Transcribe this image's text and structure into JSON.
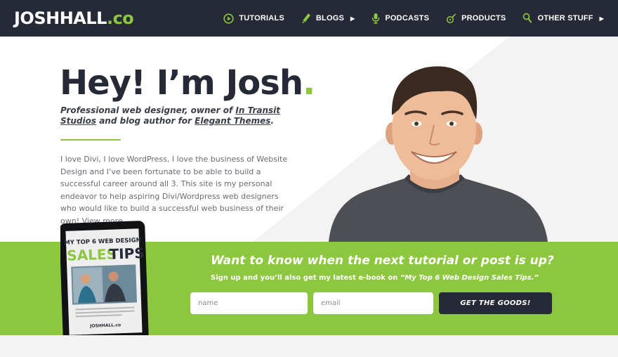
{
  "site": {
    "logo_main": "JOSHHALL",
    "logo_tld": ".co"
  },
  "nav": {
    "items": [
      {
        "label": "TUTORIALS",
        "icon": "play-circle-icon",
        "has_dropdown": false
      },
      {
        "label": "BLOGS",
        "icon": "pencil-icon",
        "has_dropdown": true
      },
      {
        "label": "PODCASTS",
        "icon": "microphone-icon",
        "has_dropdown": false
      },
      {
        "label": "PRODUCTS",
        "icon": "guitar-pick-icon",
        "has_dropdown": false
      },
      {
        "label": "OTHER STUFF",
        "icon": "magnifier-icon",
        "has_dropdown": true
      }
    ],
    "dropdown_glyph": "▶"
  },
  "hero": {
    "title": "Hey! I’m Josh",
    "title_dot": ".",
    "subtitle_pre": "Professional web designer, owner of ",
    "subtitle_link1": "In Transit Studios",
    "subtitle_mid": " and blog author for ",
    "subtitle_link2": "Elegant Themes",
    "subtitle_post": ".",
    "bio": "I love Divi, I love WordPress, I love the business of Website Design and I’ve been fortunate to be able to build a successful career around all 3. This site is my personal endeavor to help aspiring Divi/Wordpress web designers who would like to build a successful web business of their own! View more..."
  },
  "optin": {
    "title": "Want to know when the next tutorial or post is up?",
    "sub_pre": "Sign up and you’ll also get my latest e-book on ",
    "sub_book": "“My Top 6 Web Design Sales Tips.”",
    "name_placeholder": "name",
    "email_placeholder": "email",
    "button_label": "GET THE GOODS!"
  },
  "ebook": {
    "line1": "MY TOP 6 WEB DESIGN",
    "line2": "SALES",
    "line3": "TIPS",
    "brand": "JOSHHALL.co"
  },
  "colors": {
    "accent": "#8dc63f",
    "dark": "#262936",
    "text_muted": "#6a6c75"
  }
}
